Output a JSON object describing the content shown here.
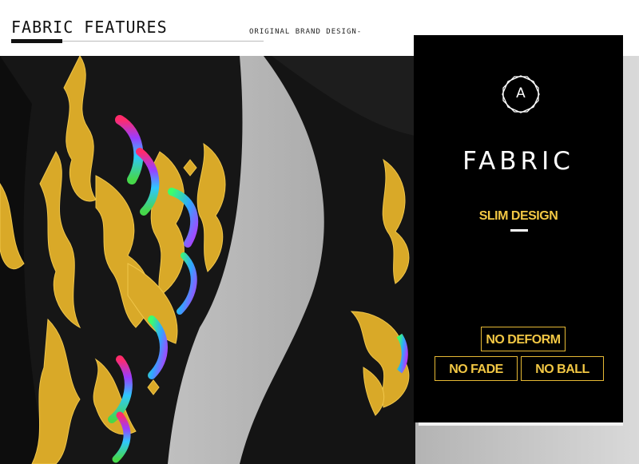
{
  "header": {
    "title": "FABRIC FEATURES",
    "subtitle": "ORIGINAL BRAND DESIGN-"
  },
  "panel": {
    "badge_letter": "A",
    "title": "FABRIC",
    "subtitle": "SLIM DESIGN",
    "tags": [
      "NO DEFORM",
      "NO FADE",
      "NO BALL"
    ]
  },
  "colors": {
    "accent_gold": "#f2c744",
    "panel_bg": "#000000",
    "garment_black": "#151515",
    "print_gold": "#d9a928"
  }
}
